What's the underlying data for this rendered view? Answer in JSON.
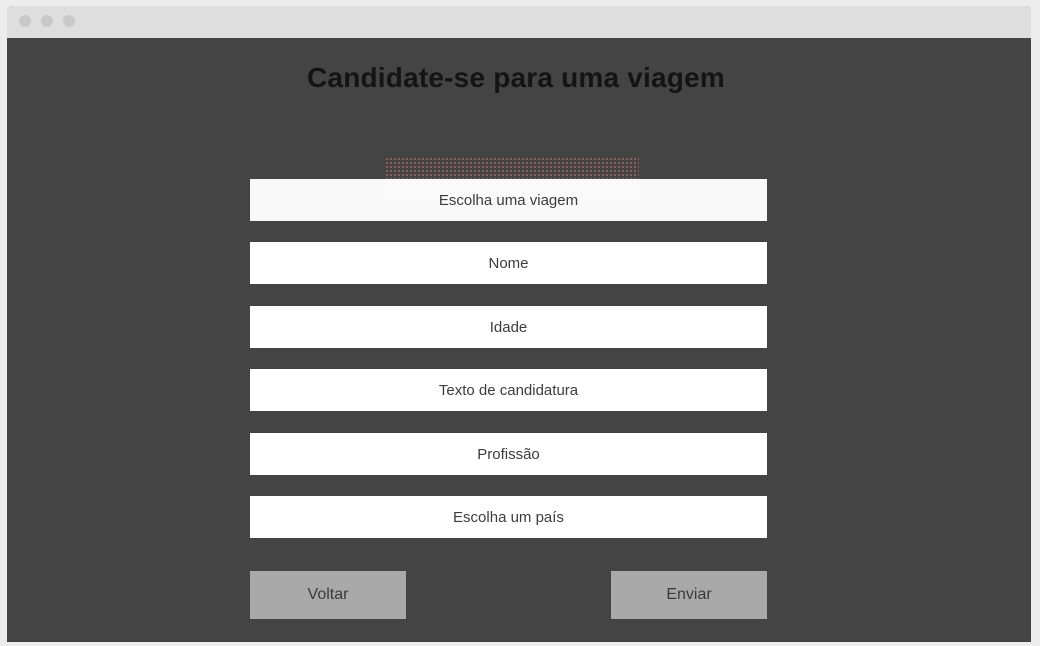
{
  "page": {
    "title": "Candidate-se para uma viagem"
  },
  "form": {
    "fields": [
      {
        "placeholder": "Escolha uma viagem"
      },
      {
        "placeholder": "Nome"
      },
      {
        "placeholder": "Idade"
      },
      {
        "placeholder": "Texto de candidatura"
      },
      {
        "placeholder": "Profissão"
      },
      {
        "placeholder": "Escolha um país"
      }
    ],
    "back_label": "Voltar",
    "submit_label": "Enviar"
  },
  "colors": {
    "background": "#444444",
    "field": "#ffffff",
    "button": "#a9a9a9",
    "titlebar": "#dedede"
  }
}
